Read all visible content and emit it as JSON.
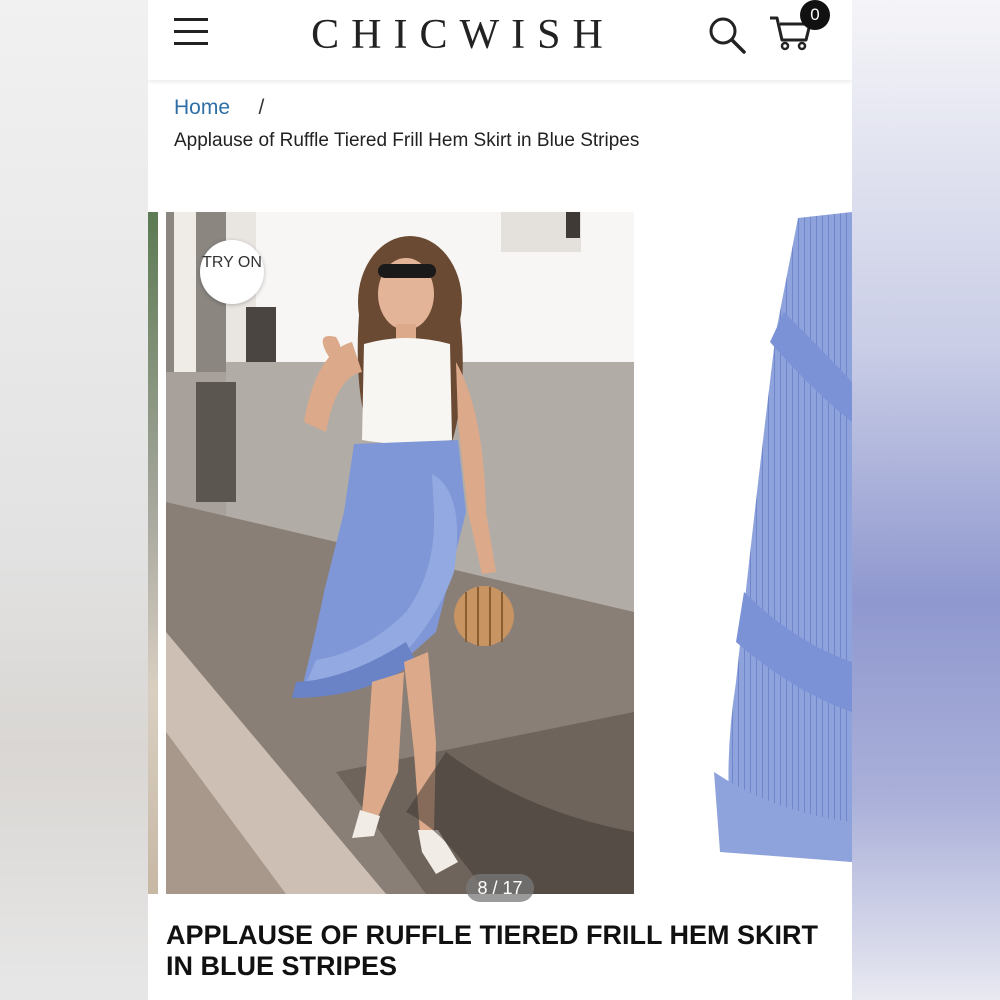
{
  "header": {
    "logo": "CHICWISH",
    "cart_count": "0",
    "icons": {
      "menu": "hamburger-menu-icon",
      "search": "search-icon",
      "cart": "cart-icon"
    }
  },
  "breadcrumb": {
    "home": "Home",
    "separator": "/",
    "current": "Applause of Ruffle Tiered Frill Hem Skirt in Blue Stripes"
  },
  "gallery": {
    "try_on": "TRY ON",
    "counter": "8 / 17"
  },
  "product": {
    "title": "APPLAUSE OF RUFFLE TIERED FRILL HEM SKIRT IN BLUE STRIPES"
  },
  "colors": {
    "link": "#2f6fa6",
    "skirt_blue": "#7f97d6",
    "text": "#111111"
  }
}
